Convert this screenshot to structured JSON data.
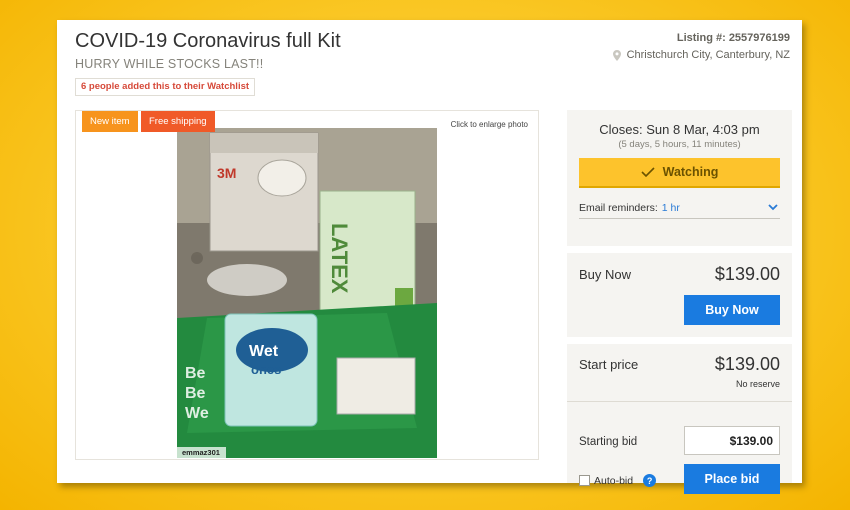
{
  "listing": {
    "title": "COVID-19 Coronavirus full Kit",
    "subtitle": "HURRY WHILE STOCKS LAST!!",
    "watchlist_count_text": "6 people added this to their Watchlist",
    "listing_number_text": "Listing #: 2557976199",
    "location": "Christchurch City, Canterbury, NZ"
  },
  "photo": {
    "tags": {
      "new_item": "New item",
      "free_shipping": "Free shipping"
    },
    "enlarge_text": "Click to enlarge photo",
    "watermark": "emmaz301",
    "icons": [
      "map-pin-icon"
    ]
  },
  "closing": {
    "closes_text": "Closes: Sun 8 Mar, 4:03 pm",
    "remaining_text": "(5 days, 5 hours, 11 minutes)",
    "watching_label": "Watching",
    "email_reminders_label": "Email reminders:",
    "email_reminders_value": "1 hr"
  },
  "buy_now": {
    "label": "Buy Now",
    "price": "$139.00",
    "button_label": "Buy Now"
  },
  "bidding": {
    "start_price_label": "Start price",
    "start_price": "$139.00",
    "reserve_text": "No reserve",
    "starting_bid_label": "Starting bid",
    "bid_value": "$139.00",
    "autobid_label": "Auto-bid",
    "help_symbol": "?",
    "place_bid_label": "Place bid"
  },
  "colors": {
    "accent_yellow": "#fdc32c",
    "button_blue": "#1a7be0",
    "tag_orange": "#f7941d",
    "tag_red": "#f05a28"
  }
}
